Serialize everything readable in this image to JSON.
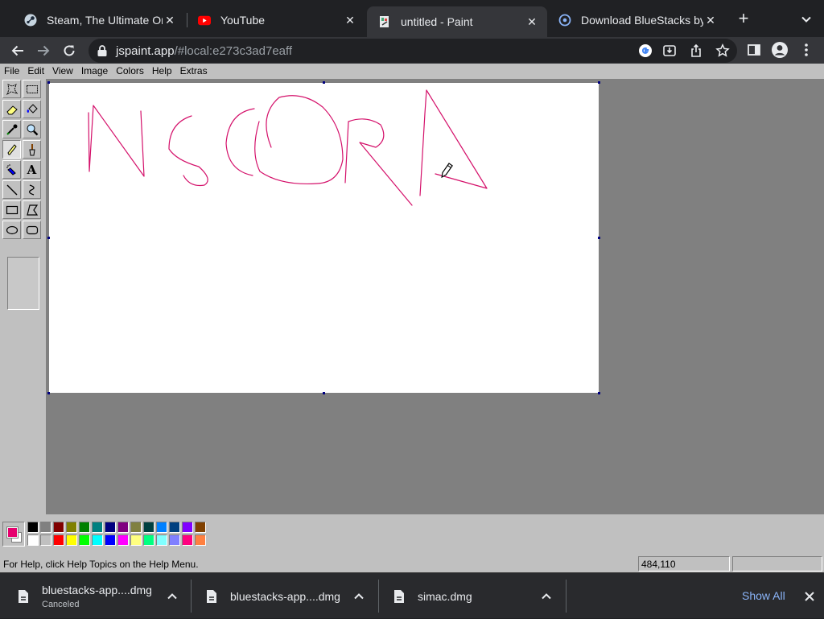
{
  "tabs": [
    {
      "title": "Steam, The Ultimate Online Game Platform",
      "active": false
    },
    {
      "title": "YouTube",
      "active": false
    },
    {
      "title": "untitled - Paint",
      "active": true
    },
    {
      "title": "Download BlueStacks by BlueStacks",
      "active": false
    }
  ],
  "toolbar": {
    "url_host": "jspaint.app",
    "url_path": "/#local:e273c3ad7eaff"
  },
  "menu": [
    "File",
    "Edit",
    "View",
    "Image",
    "Colors",
    "Help",
    "Extras"
  ],
  "tools": [
    {
      "name": "free-form-select-tool"
    },
    {
      "name": "select-tool"
    },
    {
      "name": "eraser-tool"
    },
    {
      "name": "fill-tool"
    },
    {
      "name": "pick-color-tool"
    },
    {
      "name": "magnifier-tool"
    },
    {
      "name": "pencil-tool"
    },
    {
      "name": "brush-tool"
    },
    {
      "name": "airbrush-tool"
    },
    {
      "name": "text-tool"
    },
    {
      "name": "line-tool"
    },
    {
      "name": "curve-tool"
    },
    {
      "name": "rectangle-tool"
    },
    {
      "name": "polygon-tool"
    },
    {
      "name": "ellipse-tool"
    },
    {
      "name": "rounded-rectangle-tool"
    }
  ],
  "text_tool_glyph": "A",
  "active_tool": "pencil-tool",
  "colors": {
    "foreground": "#e6006e",
    "background": "#ffffff",
    "palette_top": [
      "#000000",
      "#808080",
      "#800000",
      "#808000",
      "#008000",
      "#008080",
      "#000080",
      "#800080",
      "#808040",
      "#004040",
      "#0080ff",
      "#004080",
      "#8000ff",
      "#804000"
    ],
    "palette_bottom": [
      "#ffffff",
      "#c0c0c0",
      "#ff0000",
      "#ffff00",
      "#00ff00",
      "#00ffff",
      "#0000ff",
      "#ff00ff",
      "#ffff80",
      "#00ff80",
      "#80ffff",
      "#8080ff",
      "#ff0080",
      "#ff8040"
    ]
  },
  "status": {
    "help_text": "For Help, click Help Topics on the Help Menu.",
    "coords": "484,110",
    "size": ""
  },
  "downloads": [
    {
      "name": "bluestacks-app....dmg",
      "status": "Canceled"
    },
    {
      "name": "bluestacks-app....dmg",
      "status": ""
    },
    {
      "name": "simac.dmg",
      "status": ""
    }
  ],
  "shelf": {
    "show_all": "Show All"
  }
}
